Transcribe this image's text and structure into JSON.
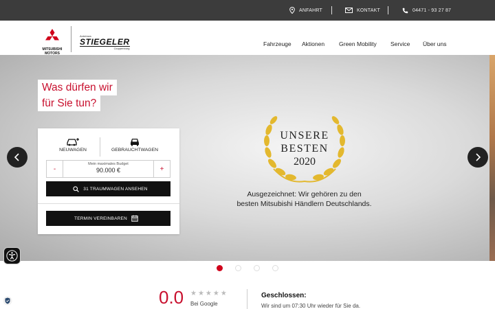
{
  "topbar": {
    "anfahrt": "ANFAHRT",
    "kontakt": "KONTAKT",
    "phone": "04471 - 93 27 87"
  },
  "logo": {
    "mitsubishi_line1": "MITSUBISHI",
    "mitsubishi_line2": "MOTORS",
    "dealer_top": "Autohaus",
    "dealer_name": "STIEGELER",
    "dealer_city": "Cloppenburg"
  },
  "nav": {
    "items": [
      "Fahrzeuge",
      "Aktionen",
      "Green Mobility",
      "Service",
      "Über uns"
    ]
  },
  "hero": {
    "question_line1": "Was dürfen wir",
    "question_line2": "für Sie tun?",
    "award_line1": "UNSERE",
    "award_line2": "BESTEN",
    "award_line3": "2020",
    "caption_line1": "Ausgezeichnet: Wir gehören zu den",
    "caption_line2": "besten Mitsubishi Händlern Deutschlands."
  },
  "search": {
    "tab_new": "NEUWAGEN",
    "tab_used": "GEBRAUCHTWAGEN",
    "budget_label": "Mein maximales Budget",
    "budget_value": "90.000 €",
    "minus": "-",
    "plus": "+",
    "search_button": "31 TRAUMWAGEN ANSEHEN",
    "appointment_button": "TERMIN VEREINBAREN"
  },
  "rating": {
    "score": "0.0",
    "stars": "★★★★★",
    "source": "Bei Google"
  },
  "hours": {
    "status": "Geschlossen:",
    "note": "Wir sind um 07:30 Uhr wieder für Sie da."
  },
  "colors": {
    "brand_red": "#c8102e",
    "topbar_bg": "#3c3c3c",
    "award_gold": "#e3b82e"
  }
}
